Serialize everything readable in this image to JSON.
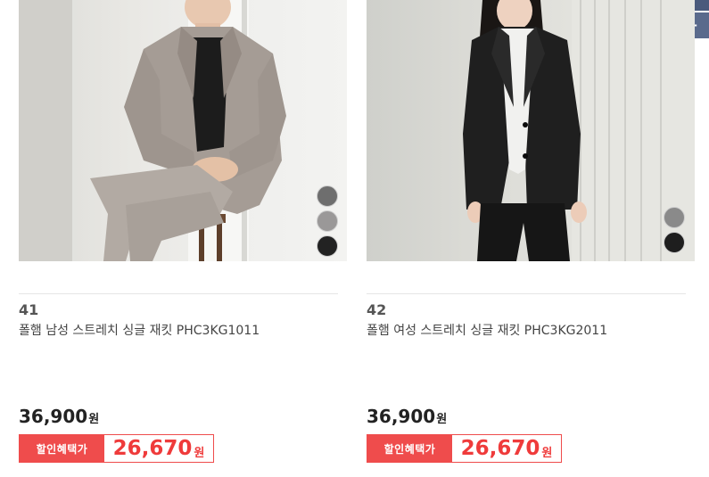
{
  "products": [
    {
      "number": "41",
      "name": "폴햄 남성 스트레치 싱글 재킷 PHC3KG1011",
      "price": "36,900",
      "currency": "원",
      "discount_label": "할인혜택가",
      "discount_price": "26,670",
      "swatch_colors": [
        "#6e6e6e",
        "#9a9898",
        "#222222"
      ]
    },
    {
      "number": "42",
      "name": "폴햄 여성 스트레치 싱글 재킷 PHC3KG2011",
      "price": "36,900",
      "currency": "원",
      "discount_label": "할인혜택가",
      "discount_price": "26,670",
      "swatch_colors": [
        "#8a8a8a",
        "#1e1e1e"
      ]
    }
  ],
  "floating_button": {
    "label": "+"
  },
  "colors": {
    "accent": "#ef4c4c",
    "floating": "#5a6a8c"
  }
}
